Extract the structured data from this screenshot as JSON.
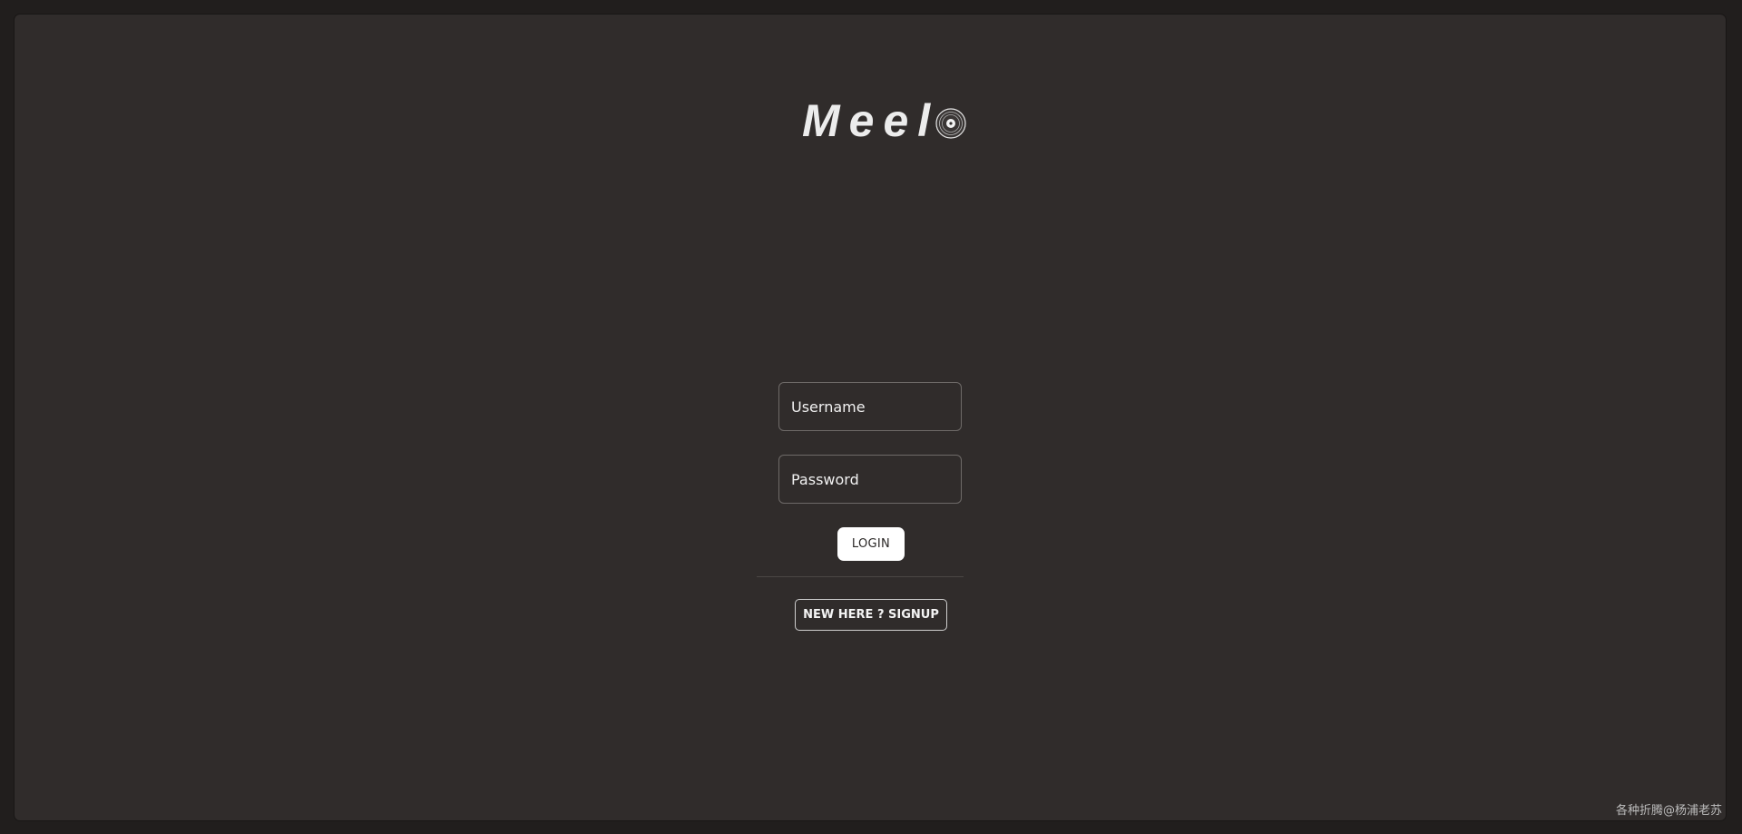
{
  "logo": {
    "text": "Meel",
    "icon": "vinyl-record-icon"
  },
  "form": {
    "username_placeholder": "Username",
    "password_placeholder": "Password",
    "login_label": "LOGIN",
    "signup_label": "NEW HERE ? SIGNUP"
  },
  "watermark": "各种折腾@杨浦老苏",
  "colors": {
    "background": "#211e1d",
    "panel": "#302c2b",
    "text": "#ececec",
    "button_bg": "#ffffff"
  }
}
